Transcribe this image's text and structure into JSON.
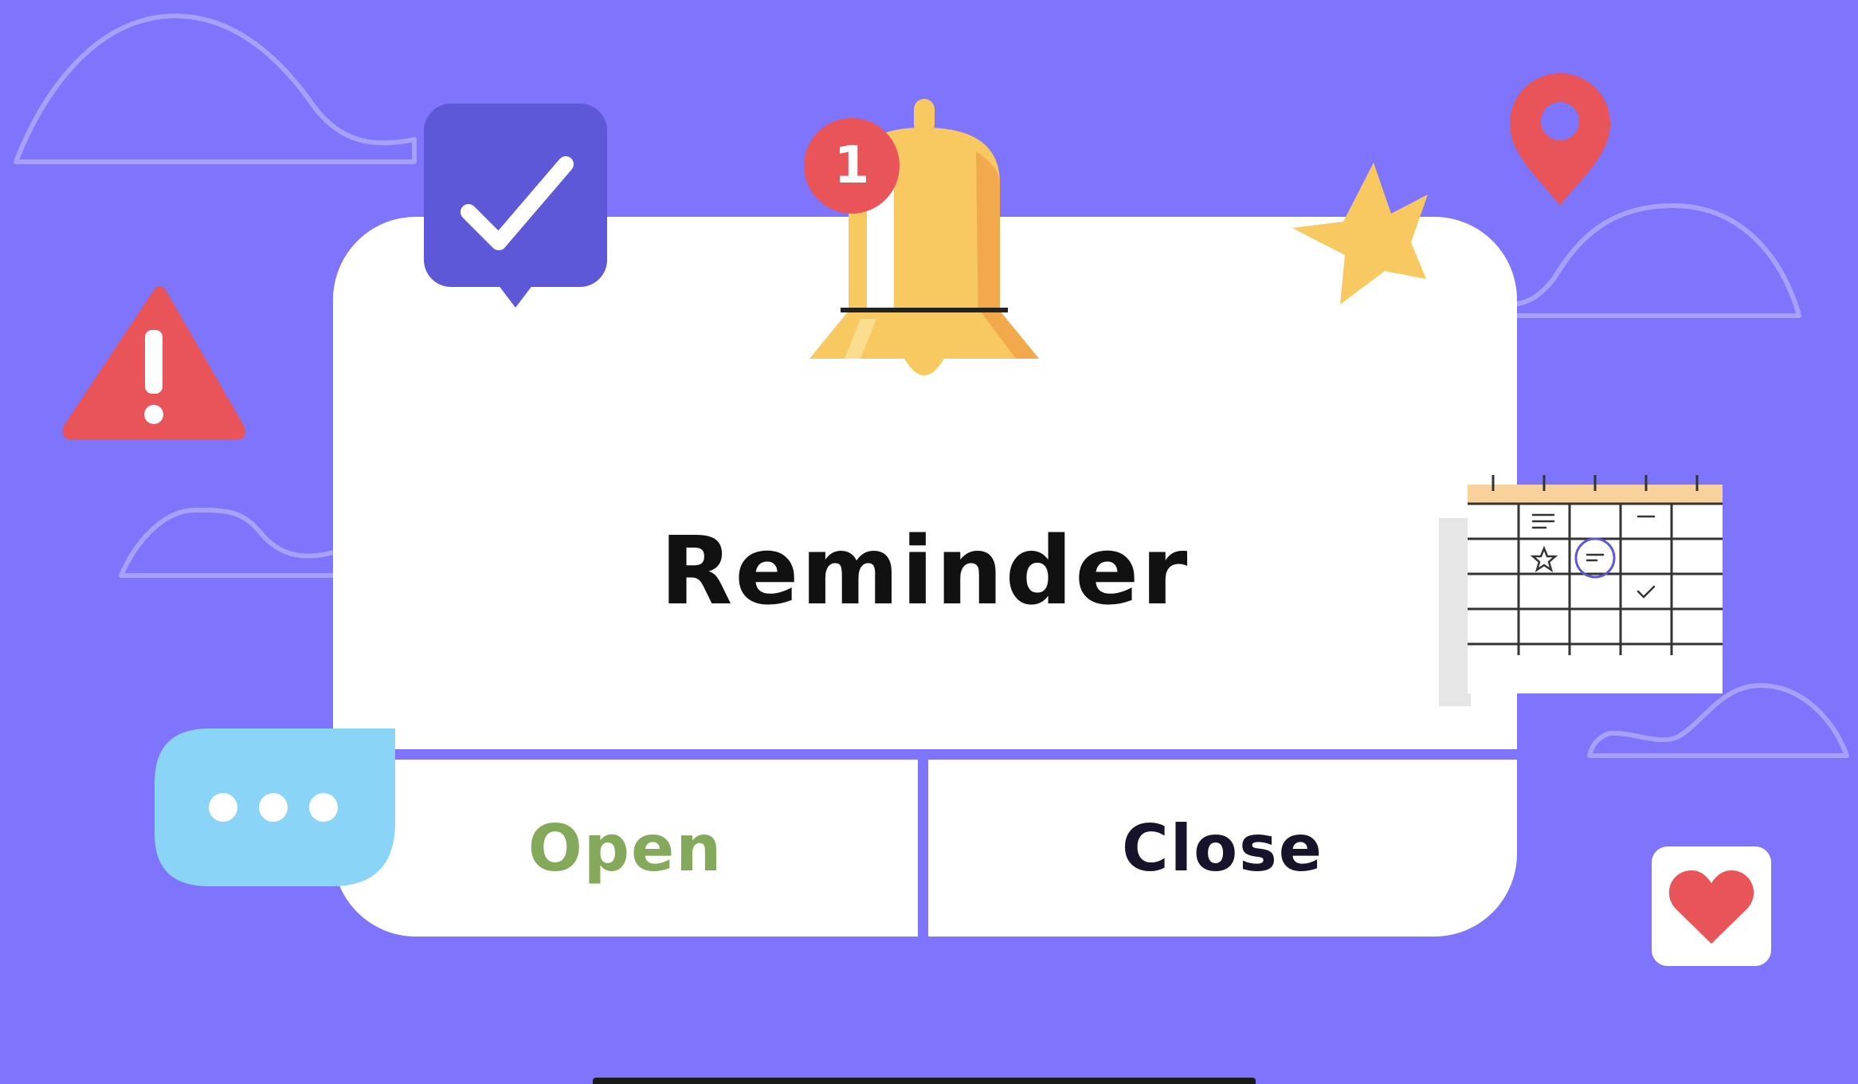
{
  "dialog": {
    "title": "Reminder",
    "open_label": "Open",
    "close_label": "Close"
  },
  "notification_badge": {
    "count": "1"
  },
  "colors": {
    "background": "#7f74fc",
    "dialog": "#ffffff",
    "open_text": "#84a95a",
    "close_text": "#16132a",
    "accent_red": "#e85458",
    "bell_yellow": "#f8c861",
    "chat_blue": "#8ad4f8",
    "check_purple": "#5d58d8"
  },
  "icons": [
    "cloud-outline-icon",
    "check-badge-icon",
    "bell-icon",
    "notification-badge",
    "star-icon",
    "location-pin-icon",
    "warning-icon",
    "calendar-icon",
    "chat-bubble-icon",
    "heart-icon"
  ]
}
